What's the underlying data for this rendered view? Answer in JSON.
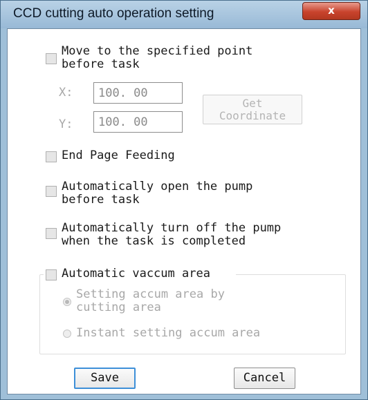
{
  "window": {
    "title": "CCD cutting auto operation setting",
    "close_label": "x"
  },
  "move_to_point": {
    "label": "Move to the specified point\nbefore task",
    "checked": false,
    "x_label": "X:",
    "x_value": "100. 00",
    "y_label": "Y:",
    "y_value": "100. 00",
    "get_coordinate_label": "Get\nCoordinate"
  },
  "end_page_feeding": {
    "label": "End Page Feeding",
    "checked": false
  },
  "open_pump": {
    "label": "Automatically open the pump\nbefore task",
    "checked": false
  },
  "turn_off_pump": {
    "label": "Automatically turn off the pump\nwhen the task is completed",
    "checked": false
  },
  "vacuum": {
    "label": "Automatic vaccum area",
    "checked": false,
    "option_by_cutting": "Setting accum area by\ncutting area",
    "option_instant": "Instant setting accum area",
    "selected": "by_cutting"
  },
  "buttons": {
    "save": "Save",
    "cancel": "Cancel"
  }
}
